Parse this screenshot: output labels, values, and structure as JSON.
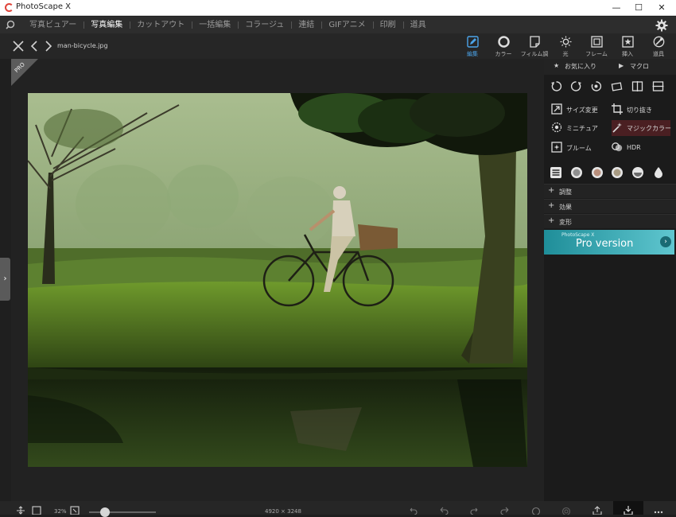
{
  "app": {
    "title": "PhotoScape X"
  },
  "window_controls": {
    "minimize": "—",
    "maximize": "☐",
    "close": "✕"
  },
  "menu": {
    "items": [
      "写真ビュアー",
      "写真編集",
      "カットアウト",
      "一括編集",
      "コラージュ",
      "連結",
      "GIFアニメ",
      "印刷",
      "道具"
    ],
    "active": "写真編集"
  },
  "editor": {
    "filename": "man-bicycle.jpg",
    "tools": [
      {
        "label": "編集",
        "icon": "edit-icon",
        "active": true
      },
      {
        "label": "カラー",
        "icon": "color-icon"
      },
      {
        "label": "フィルム調",
        "icon": "film-icon"
      },
      {
        "label": "光",
        "icon": "light-icon"
      },
      {
        "label": "フレーム",
        "icon": "frame-icon"
      },
      {
        "label": "挿入",
        "icon": "insert-icon"
      },
      {
        "label": "道具",
        "icon": "tools-icon"
      }
    ],
    "pro_badge": "PRO"
  },
  "panel": {
    "favorites": "お気に入り",
    "macro": "マクロ",
    "functions": [
      {
        "label": "サイズ変更",
        "icon": "resize-icon"
      },
      {
        "label": "切り抜き",
        "icon": "crop-icon"
      },
      {
        "label": "ミニチュア",
        "icon": "miniature-icon"
      },
      {
        "label": "マジックカラー",
        "icon": "magic-color-icon",
        "highlight": true
      },
      {
        "label": "ブルーム",
        "icon": "bloom-icon"
      },
      {
        "label": "HDR",
        "icon": "hdr-icon"
      }
    ],
    "sections": [
      "調整",
      "効果",
      "変形"
    ],
    "pro_banner": {
      "small": "PhotoScape X",
      "big": "Pro version"
    }
  },
  "statusbar": {
    "zoom": "32%",
    "dimensions": "4920 × 3248"
  },
  "colors": {
    "accent": "#4ba3e8",
    "pro_banner": "#3aaeb9",
    "highlight": "#4a1f22"
  }
}
